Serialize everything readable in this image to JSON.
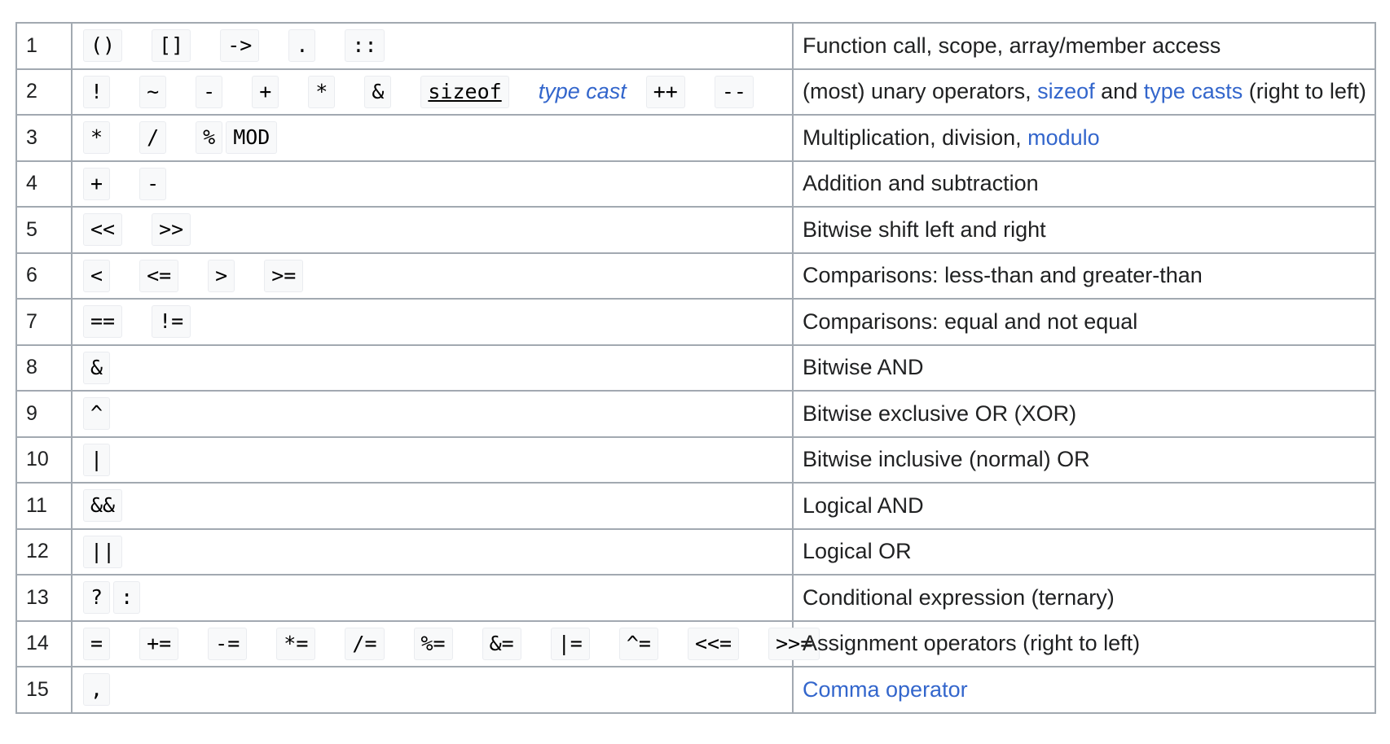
{
  "colors": {
    "link": "#3366cc",
    "border": "#a2a9b1",
    "code_background": "#f8f9fa",
    "code_border": "#eaecf0",
    "text": "#202122"
  },
  "rows": [
    {
      "num": "1",
      "ops": [
        {
          "text": "()"
        },
        {
          "text": "[]"
        },
        {
          "text": "->"
        },
        {
          "text": "."
        },
        {
          "text": "::"
        }
      ],
      "desc": [
        {
          "text": "Function call, scope, array/member access"
        }
      ]
    },
    {
      "num": "2",
      "ops": [
        {
          "text": "!"
        },
        {
          "text": "~"
        },
        {
          "text": "-"
        },
        {
          "text": "+"
        },
        {
          "text": "*"
        },
        {
          "text": "&"
        },
        {
          "text": "sizeof",
          "style": "keyword"
        },
        {
          "text": "type cast",
          "style": "link"
        },
        {
          "text": "++"
        },
        {
          "text": "--"
        }
      ],
      "desc": [
        {
          "text": "(most) unary operators, "
        },
        {
          "text": "sizeof",
          "link": true
        },
        {
          "text": " and "
        },
        {
          "text": "type casts",
          "link": true
        },
        {
          "text": " (right to left)"
        }
      ]
    },
    {
      "num": "3",
      "ops": [
        {
          "text": "*"
        },
        {
          "text": "/"
        },
        {
          "text": "%",
          "tight": true
        },
        {
          "text": "MOD"
        }
      ],
      "desc": [
        {
          "text": "Multiplication, division, "
        },
        {
          "text": "modulo",
          "link": true
        }
      ]
    },
    {
      "num": "4",
      "ops": [
        {
          "text": "+"
        },
        {
          "text": "-"
        }
      ],
      "desc": [
        {
          "text": "Addition and subtraction"
        }
      ]
    },
    {
      "num": "5",
      "ops": [
        {
          "text": "<<"
        },
        {
          "text": ">>"
        }
      ],
      "desc": [
        {
          "text": "Bitwise shift left and right"
        }
      ]
    },
    {
      "num": "6",
      "ops": [
        {
          "text": "<"
        },
        {
          "text": "<="
        },
        {
          "text": ">"
        },
        {
          "text": ">="
        }
      ],
      "desc": [
        {
          "text": "Comparisons: less-than and greater-than"
        }
      ]
    },
    {
      "num": "7",
      "ops": [
        {
          "text": "=="
        },
        {
          "text": "!="
        }
      ],
      "desc": [
        {
          "text": "Comparisons: equal and not equal"
        }
      ]
    },
    {
      "num": "8",
      "ops": [
        {
          "text": "&"
        }
      ],
      "desc": [
        {
          "text": "Bitwise AND"
        }
      ]
    },
    {
      "num": "9",
      "ops": [
        {
          "text": "^"
        }
      ],
      "desc": [
        {
          "text": "Bitwise exclusive OR (XOR)"
        }
      ]
    },
    {
      "num": "10",
      "ops": [
        {
          "text": "|"
        }
      ],
      "desc": [
        {
          "text": "Bitwise inclusive (normal) OR"
        }
      ]
    },
    {
      "num": "11",
      "ops": [
        {
          "text": "&&"
        }
      ],
      "desc": [
        {
          "text": "Logical AND"
        }
      ]
    },
    {
      "num": "12",
      "ops": [
        {
          "text": "||"
        }
      ],
      "desc": [
        {
          "text": "Logical OR"
        }
      ]
    },
    {
      "num": "13",
      "ops": [
        {
          "text": "?",
          "tight": true
        },
        {
          "text": ":"
        }
      ],
      "desc": [
        {
          "text": "Conditional expression (ternary)"
        }
      ]
    },
    {
      "num": "14",
      "ops": [
        {
          "text": "="
        },
        {
          "text": "+="
        },
        {
          "text": "-="
        },
        {
          "text": "*="
        },
        {
          "text": "/="
        },
        {
          "text": "%="
        },
        {
          "text": "&="
        },
        {
          "text": "|="
        },
        {
          "text": "^="
        },
        {
          "text": "<<="
        },
        {
          "text": ">>="
        }
      ],
      "desc": [
        {
          "text": "Assignment operators (right to left)"
        }
      ]
    },
    {
      "num": "15",
      "ops": [
        {
          "text": ","
        }
      ],
      "desc": [
        {
          "text": "Comma operator",
          "link": true
        }
      ]
    }
  ]
}
